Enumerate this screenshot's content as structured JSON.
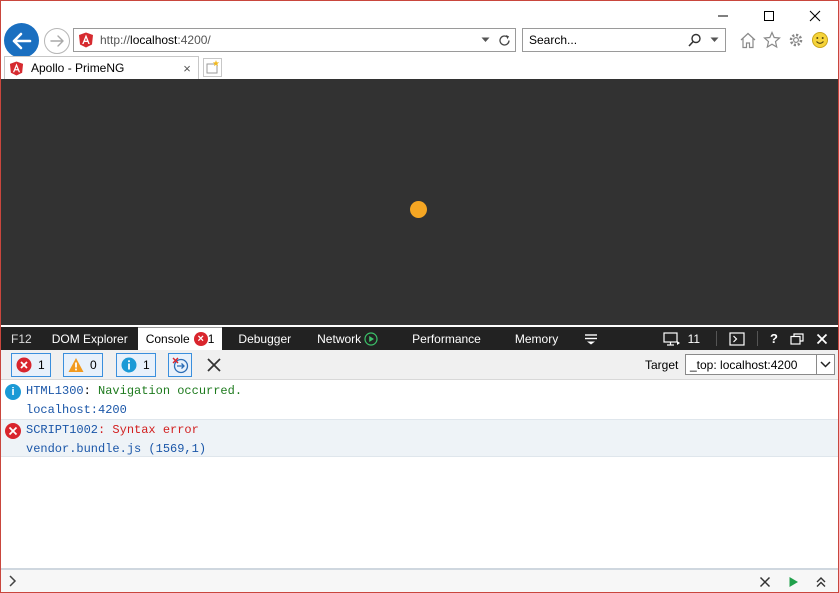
{
  "browser": {
    "address_scheme": "http://",
    "address_host": "localhost",
    "address_rest": ":4200/",
    "search_placeholder": "Search...",
    "tab_title": "Apollo - PrimeNG",
    "tab_close": "×"
  },
  "devtools": {
    "tabs": {
      "f12": "F12",
      "dom_explorer": "DOM Explorer",
      "console": "Console",
      "console_error_count": "1",
      "debugger": "Debugger",
      "network": "Network",
      "performance": "Performance",
      "memory": "Memory",
      "emulation_count": "11"
    },
    "filters": {
      "errors": "1",
      "warnings": "0",
      "messages": "1"
    },
    "target_label": "Target",
    "target_value": "_top: localhost:4200"
  },
  "console": {
    "messages": [
      {
        "type": "info",
        "code": "HTML1300",
        "separator": ":",
        "text": " Navigation occurred.",
        "source": "localhost:4200"
      },
      {
        "type": "error",
        "code": "SCRIPT1002",
        "separator": ":",
        "text": " Syntax error",
        "source": "vendor.bundle.js (1569,1)"
      }
    ]
  },
  "colors": {
    "accent_blue": "#1a6fc0",
    "loader_orange": "#f5a623",
    "page_bg": "#323232",
    "error_red": "#d9252d",
    "warning_orange": "#f29a1e",
    "info_blue": "#1b9ad6"
  }
}
